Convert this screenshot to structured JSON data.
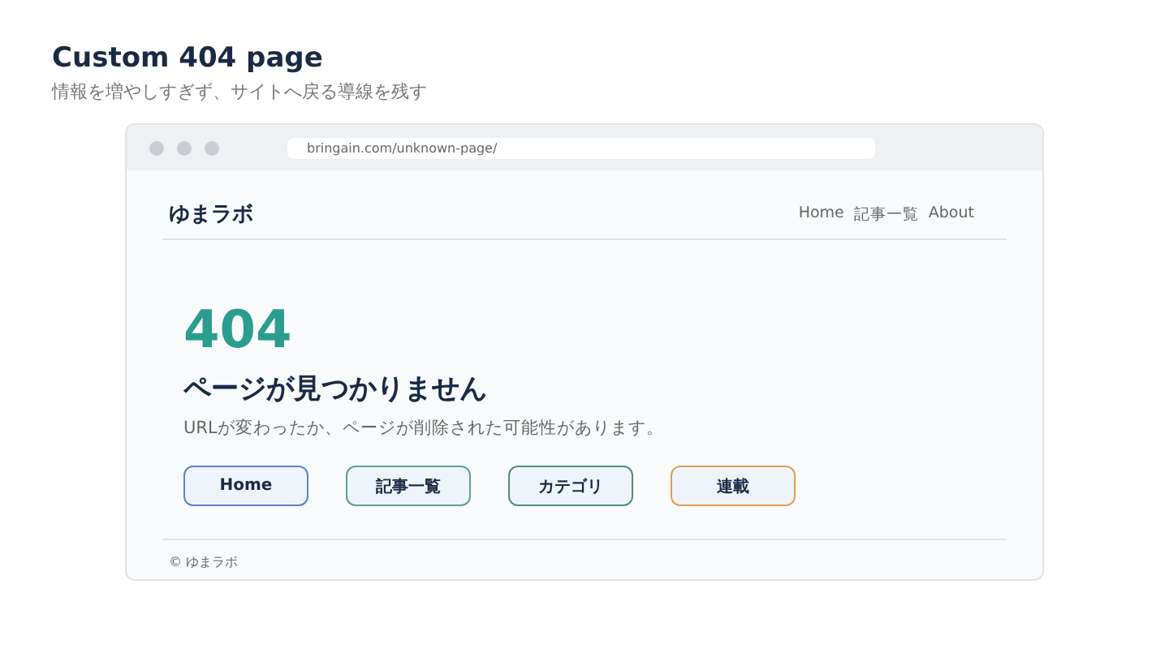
{
  "slide": {
    "title": "Custom 404 page",
    "subtitle": "情報を増やしすぎず、サイトへ戻る導線を残す"
  },
  "browser": {
    "url": "bringain.com/unknown-page/"
  },
  "site": {
    "logo": "ゆまラボ",
    "nav": [
      "Home",
      "記事一覧",
      "About"
    ]
  },
  "error": {
    "code": "404",
    "heading": "ページが見つかりません",
    "message": "URLが変わったか、ページが削除された可能性があります。"
  },
  "buttons": [
    {
      "label": "Home",
      "color": "#5b82c4"
    },
    {
      "label": "記事一覧",
      "color": "#5fa08f"
    },
    {
      "label": "カテゴリ",
      "color": "#4f8f7a"
    },
    {
      "label": "連載",
      "color": "#e0a050"
    }
  ],
  "footer": "© ゆまラボ"
}
